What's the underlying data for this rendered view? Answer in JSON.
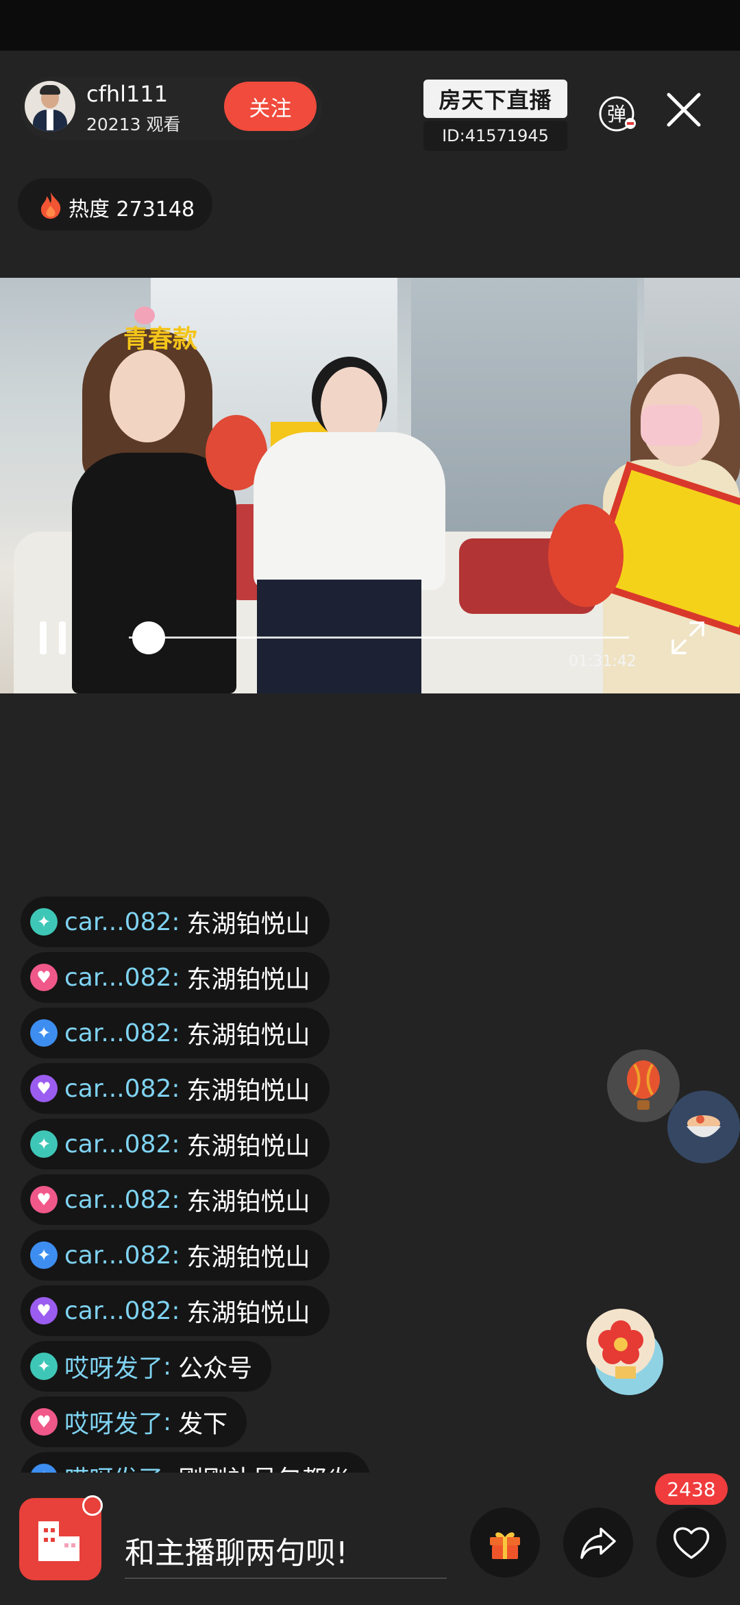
{
  "host": {
    "name": "cfhl111",
    "viewers": "20213 观看",
    "follow_label": "关注"
  },
  "brand": {
    "title": "房天下直播",
    "room_id": "ID:41571945"
  },
  "controls": {
    "danmu_label": "弹"
  },
  "heat": {
    "label": "热度 273148"
  },
  "video": {
    "headband_text": "青春款",
    "elapsed": "01:31:42",
    "progress": 0.04
  },
  "chat": [
    {
      "badge": "teal",
      "user": "car...082",
      "sep": ":",
      "msg": "东湖铂悦山"
    },
    {
      "badge": "pink",
      "user": "car...082",
      "sep": ":",
      "msg": "东湖铂悦山"
    },
    {
      "badge": "blue",
      "user": "car...082",
      "sep": ":",
      "msg": "东湖铂悦山"
    },
    {
      "badge": "purple",
      "user": "car...082",
      "sep": ":",
      "msg": "东湖铂悦山"
    },
    {
      "badge": "teal",
      "user": "car...082",
      "sep": ":",
      "msg": "东湖铂悦山"
    },
    {
      "badge": "pink",
      "user": "car...082",
      "sep": ":",
      "msg": "东湖铂悦山"
    },
    {
      "badge": "blue",
      "user": "car...082",
      "sep": ":",
      "msg": "东湖铂悦山"
    },
    {
      "badge": "purple",
      "user": "car...082",
      "sep": ":",
      "msg": "东湖铂悦山"
    },
    {
      "badge": "teal",
      "user": "哎呀发了",
      "sep": ":",
      "msg": "公众号"
    },
    {
      "badge": "pink",
      "user": "哎呀发了",
      "sep": ":",
      "msg": "发下"
    },
    {
      "badge": "blue",
      "user": "哎呀发了",
      "sep": ":",
      "msg": "刚刚补号包都炎"
    }
  ],
  "badge_colors": {
    "teal": "#3ec7b6",
    "pink": "#f0588a",
    "blue": "#3d8ef0",
    "purple": "#9b5cf0"
  },
  "bottom": {
    "input_placeholder": "和主播聊两句呗!",
    "like_count": "2438"
  },
  "colors": {
    "background": "#232323",
    "accent_red": "#f04b3c",
    "chat_name": "#7fd3f2"
  }
}
